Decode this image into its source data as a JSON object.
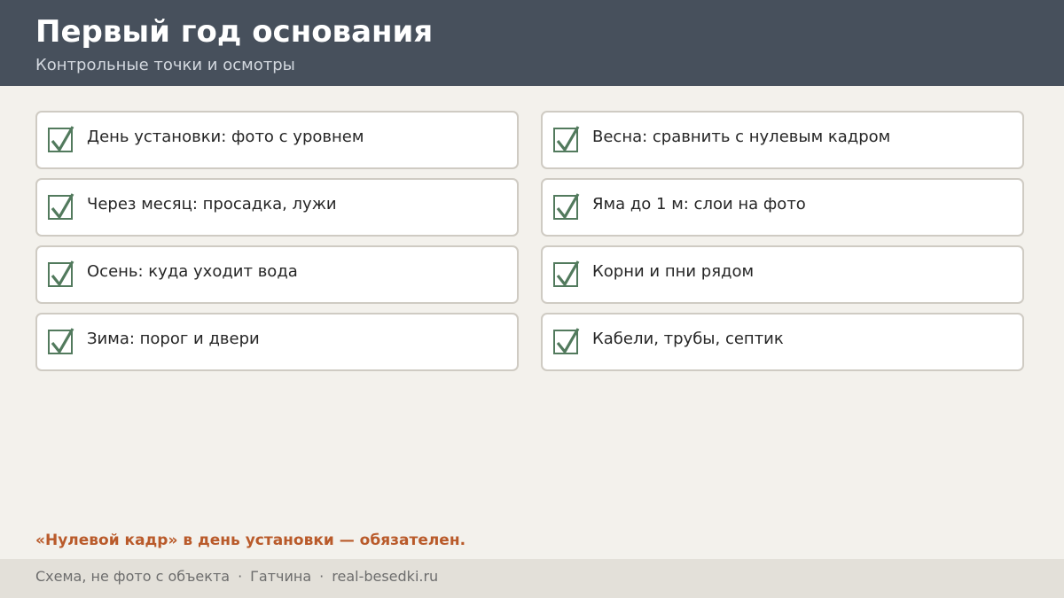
{
  "header": {
    "title": "Первый год основания",
    "subtitle": "Контрольные точки и осмотры"
  },
  "checklist": {
    "left": [
      {
        "label": "День установки: фото с уровнем",
        "checked": true
      },
      {
        "label": "Через месяц: просадка, лужи",
        "checked": true
      },
      {
        "label": "Осень: куда уходит вода",
        "checked": true
      },
      {
        "label": "Зима: порог и двери",
        "checked": true
      }
    ],
    "right": [
      {
        "label": "Весна: сравнить с нулевым кадром",
        "checked": true
      },
      {
        "label": "Яма до 1 м: слои на фото",
        "checked": true
      },
      {
        "label": "Корни и пни рядом",
        "checked": true
      },
      {
        "label": "Кабели, трубы, септик",
        "checked": true
      }
    ]
  },
  "note": "«Нулевой кадр» в день установки — обязателен.",
  "footer": {
    "caption": "Схема, не фото с объекта",
    "separator": "·",
    "city": "Гатчина",
    "site": "real-besedki.ru"
  },
  "colors": {
    "header_bg": "#47505c",
    "check": "#527a5d",
    "note": "#b95a2a",
    "footer_bg": "#e3e0d9"
  }
}
